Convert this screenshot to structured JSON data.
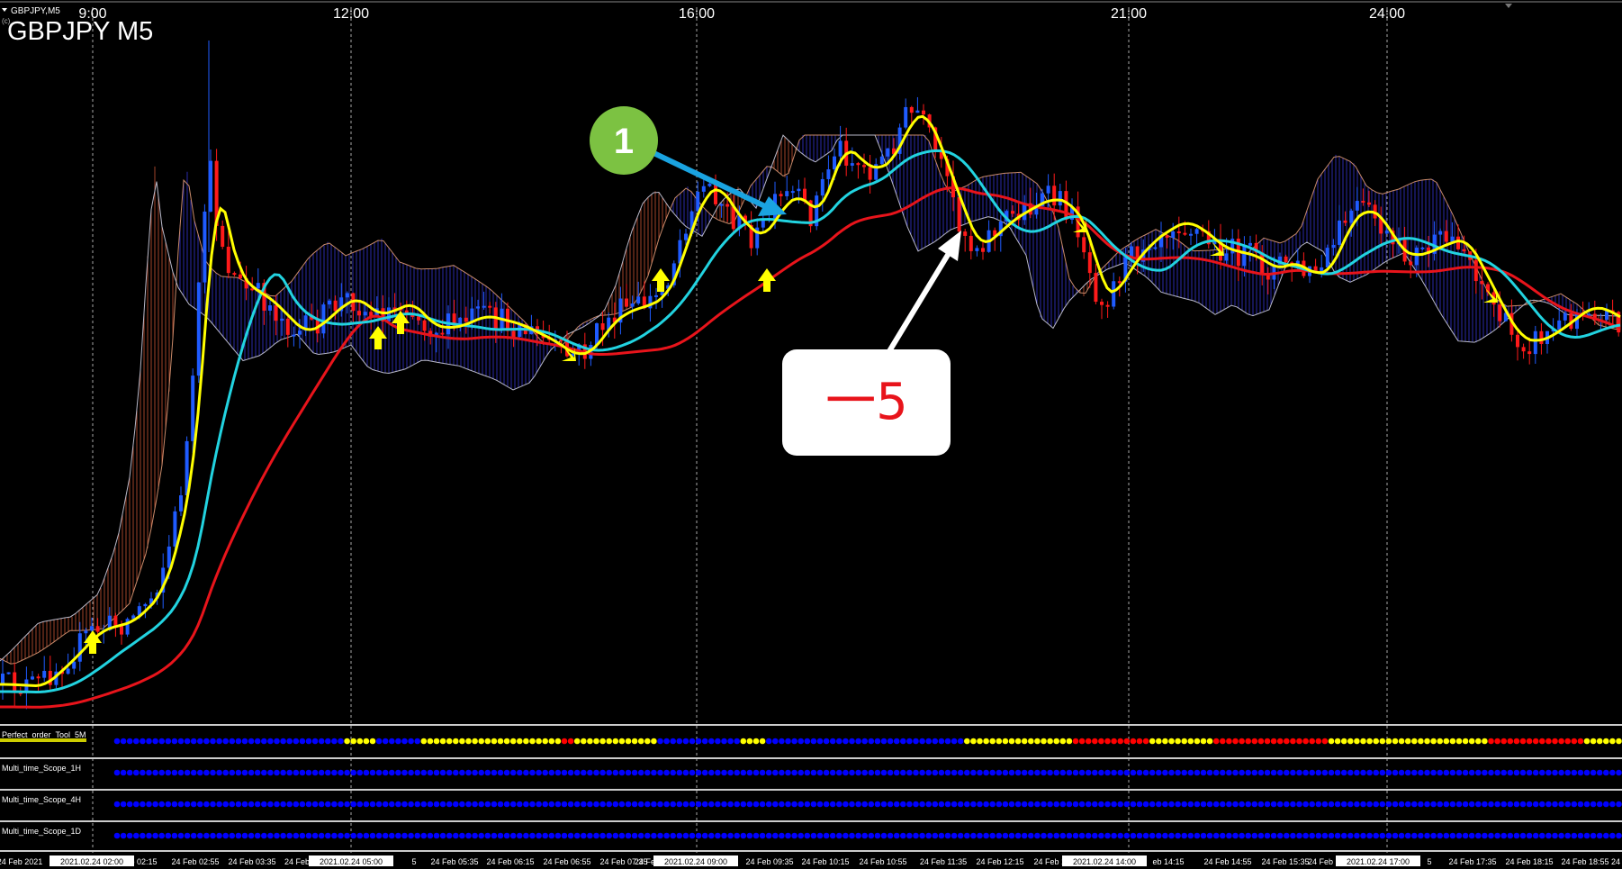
{
  "window": {
    "small_title": "GBPJPY,M5",
    "small_subtitle": "(c) ...",
    "big_title": "GBPJPY M5"
  },
  "top_times": [
    "9:00",
    "12:00",
    "16:00",
    "21:00",
    "24:00"
  ],
  "annotations": {
    "badge_number": "1",
    "callout_text": "一5",
    "badge_color": "#7cc242",
    "callout_text_color": "#e8141b"
  },
  "indicators": [
    {
      "label": "Perfect_order_Tool_5M"
    },
    {
      "label": "Multi_time_Scope_1H"
    },
    {
      "label": "Multi_time_Scope_4H"
    },
    {
      "label": "Multi_time_Scope_1D"
    }
  ],
  "bottom_axis": {
    "labels": [
      "24 Feb 2021",
      "2021.02.24 02:00",
      "eb 02:15",
      "24 Feb 02:55",
      "24 Feb 03:35",
      "24 Feb",
      "2021.02.24 05:00",
      "5",
      "24 Feb 05:35",
      "24 Feb 06:15",
      "24 Feb 06:55",
      "24 Feb 07:35",
      "24 Feb",
      "2021.02.24 09:00",
      "5",
      "24 Feb 09:35",
      "24 Feb 10:15",
      "24 Feb 10:55",
      "24 Feb 11:35",
      "24 Feb 12:15",
      "24 Feb 12:55",
      "2021.02.24 14:00",
      "eb 14:15",
      "24 Feb 14:55",
      "24 Feb 15:35",
      "24 Feb",
      "2021.02.24 17:00",
      "5",
      "24 Feb 17:35",
      "24 Feb 18:15",
      "24 Feb 18:55",
      "24"
    ],
    "highlighted": [
      "2021.02.24 02:00",
      "2021.02.24 05:00",
      "2021.02.24 09:00",
      "2021.02.24 14:00",
      "2021.02.24 17:00"
    ]
  },
  "colors": {
    "background": "#000000",
    "bull_candle": "#1f5bff",
    "bear_candle": "#ff1a1a",
    "ma_fast": "#ffff00",
    "ma_mid": "#22d3e0",
    "ma_slow": "#e8141b",
    "arrow_signal": "#ffff00",
    "arrow_callout_1": "#1aa3e0",
    "arrow_callout_2": "#ffffff",
    "cloud_bull": "#2a2aa8",
    "cloud_bear": "#a0452a",
    "grid": "#9a9a9a",
    "dot_blue": "#0000ff",
    "dot_yellow": "#ffff00",
    "dot_red": "#ff0000"
  }
}
